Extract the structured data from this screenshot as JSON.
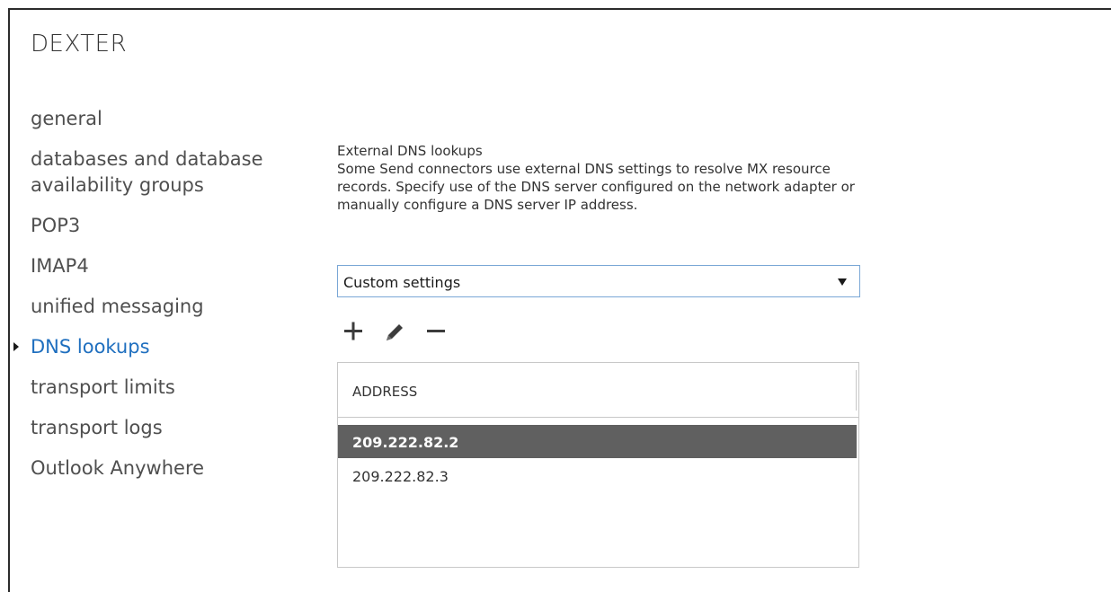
{
  "window": {
    "title": "DEXTER"
  },
  "sidebar": {
    "items": [
      {
        "label": "general",
        "active": false
      },
      {
        "label": "databases and database\navailability groups",
        "active": false
      },
      {
        "label": "POP3",
        "active": false
      },
      {
        "label": "IMAP4",
        "active": false
      },
      {
        "label": "unified messaging",
        "active": false
      },
      {
        "label": "DNS lookups",
        "active": true
      },
      {
        "label": "transport limits",
        "active": false
      },
      {
        "label": "transport logs",
        "active": false
      },
      {
        "label": "Outlook Anywhere",
        "active": false
      }
    ]
  },
  "external_dns": {
    "title": "External DNS lookups",
    "description": "Some Send connectors use external DNS settings to resolve MX resource records. Specify use of the DNS server configured on the network adapter or manually configure a DNS server IP address.",
    "select_value": "Custom settings"
  },
  "toolbar": {
    "add_icon": "plus-icon",
    "edit_icon": "pencil-icon",
    "remove_icon": "minus-icon"
  },
  "address_table": {
    "column_header": "ADDRESS",
    "rows": [
      {
        "address": "209.222.82.2",
        "selected": true
      },
      {
        "address": "209.222.82.3",
        "selected": false
      }
    ]
  },
  "colors": {
    "active_nav": "#1f6fbf",
    "selected_row": "#606060",
    "select_border": "#7aa7d6"
  }
}
